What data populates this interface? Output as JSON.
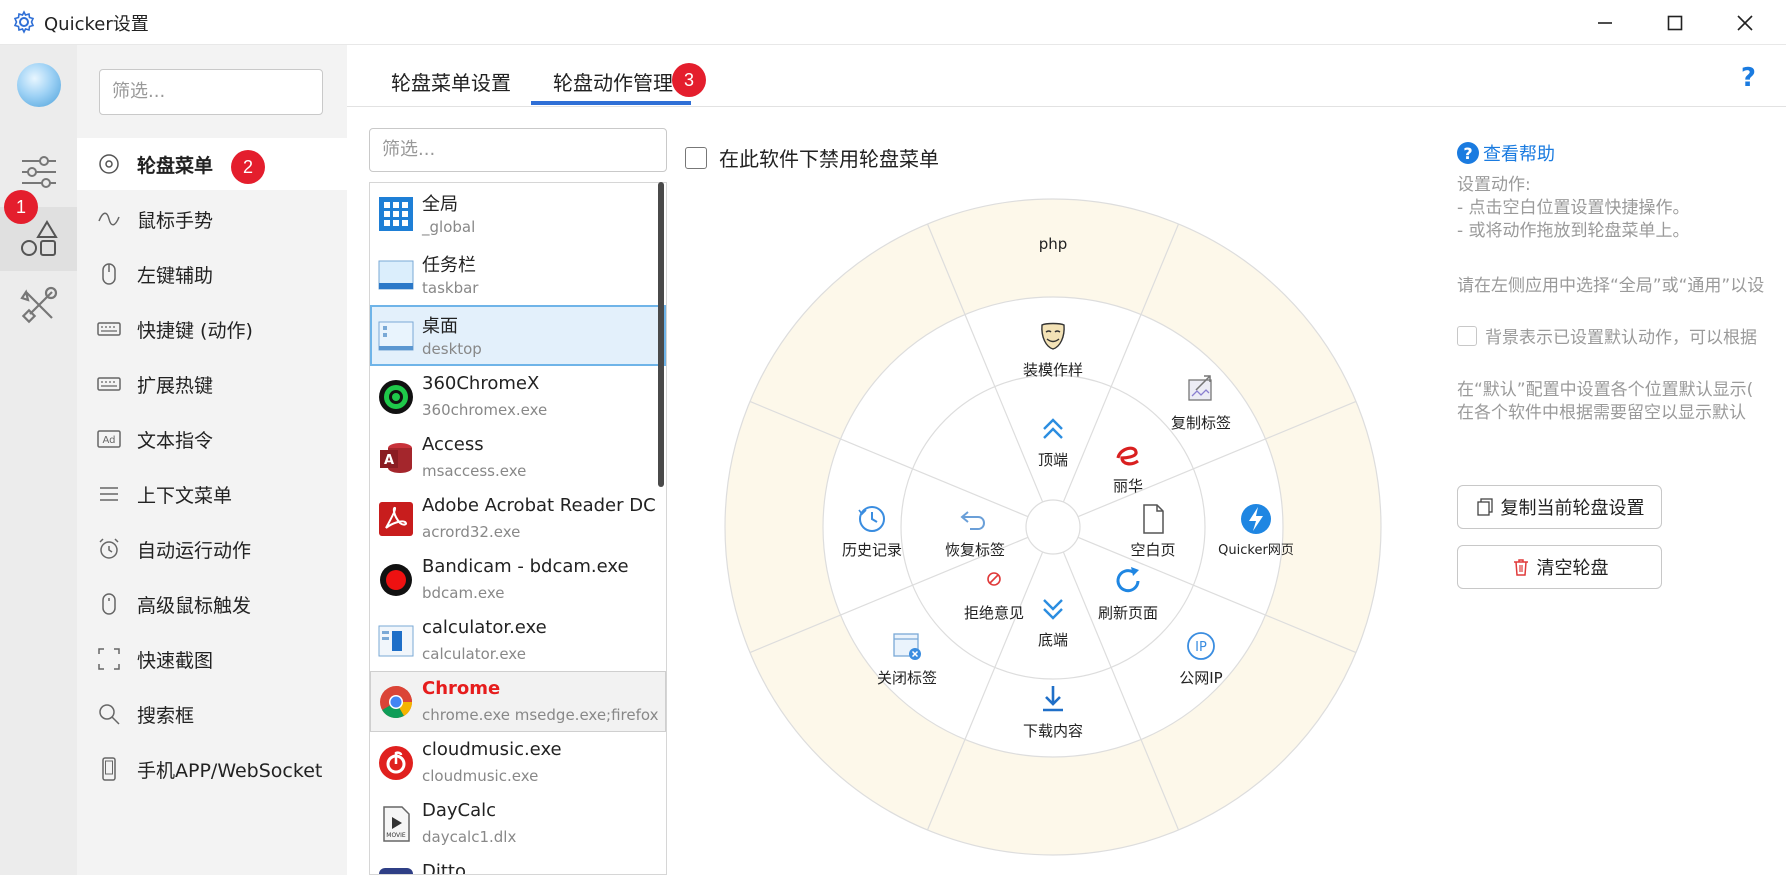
{
  "window": {
    "title": "Quicker设置",
    "controls": {
      "minimize": "minimize",
      "maximize": "maximize",
      "close": "close"
    }
  },
  "rail": {
    "items": [
      "avatar",
      "sliders-icon",
      "shapes-icon",
      "tools-icon"
    ],
    "badge": "1"
  },
  "sidebar": {
    "filter_placeholder": "筛选...",
    "items": [
      {
        "label": "轮盘菜单",
        "icon": "circle-dot-icon"
      },
      {
        "label": "鼠标手势",
        "icon": "wave-icon"
      },
      {
        "label": "左键辅助",
        "icon": "mouse-icon"
      },
      {
        "label": "快捷键 (动作)",
        "icon": "keyboard-icon"
      },
      {
        "label": "扩展热键",
        "icon": "keyboard-icon"
      },
      {
        "label": "文本指令",
        "icon": "ad-icon"
      },
      {
        "label": "上下文菜单",
        "icon": "menu-lines-icon"
      },
      {
        "label": "自动运行动作",
        "icon": "alarm-icon"
      },
      {
        "label": "高级鼠标触发",
        "icon": "mouse-icon"
      },
      {
        "label": "快速截图",
        "icon": "screenshot-icon"
      },
      {
        "label": "搜索框",
        "icon": "search-icon"
      },
      {
        "label": "手机APP/WebSocket",
        "icon": "phone-icon"
      }
    ],
    "badge": "2"
  },
  "tabs": {
    "items": [
      "轮盘菜单设置",
      "轮盘动作管理"
    ],
    "active": 1,
    "badge": "3",
    "help": "?"
  },
  "apps": {
    "filter_placeholder": "筛选...",
    "items": [
      {
        "name": "全局",
        "sub": "_global",
        "icon": "grid-icon"
      },
      {
        "name": "任务栏",
        "sub": "taskbar",
        "icon": "taskbar-icon"
      },
      {
        "name": "桌面",
        "sub": "desktop",
        "icon": "desktop-icon"
      },
      {
        "name": "360ChromeX",
        "sub": "360chromex.exe",
        "icon": "360chrome-icon"
      },
      {
        "name": "Access",
        "sub": "msaccess.exe",
        "icon": "access-icon"
      },
      {
        "name": "Adobe Acrobat Reader DC",
        "sub": "acrord32.exe",
        "icon": "acrobat-icon"
      },
      {
        "name": "Bandicam - bdcam.exe",
        "sub": "bdcam.exe",
        "icon": "bandicam-icon"
      },
      {
        "name": "calculator.exe",
        "sub": "calculator.exe",
        "icon": "calculator-icon"
      },
      {
        "name": "Chrome",
        "sub": "chrome.exe  msedge.exe;firefox",
        "icon": "chrome-icon"
      },
      {
        "name": "cloudmusic.exe",
        "sub": "cloudmusic.exe",
        "icon": "cloudmusic-icon"
      },
      {
        "name": "DayCalc",
        "sub": "daycalc1.dlx",
        "icon": "movie-icon"
      },
      {
        "name": "Ditto",
        "sub": "",
        "icon": "ditto-icon"
      }
    ]
  },
  "main": {
    "disable_label": "在此软件下禁用轮盘菜单"
  },
  "wheel": {
    "outer_top": "php",
    "actions": [
      {
        "label": "装模作样",
        "icon": "mask-icon"
      },
      {
        "label": "复制标签",
        "icon": "copy-tag-icon"
      },
      {
        "label": "顶端",
        "icon": "double-up-icon"
      },
      {
        "label": "丽华",
        "icon": "lihua-icon"
      },
      {
        "label": "历史记录",
        "icon": "history-icon"
      },
      {
        "label": "恢复标签",
        "icon": "undo-icon"
      },
      {
        "label": "空白页",
        "icon": "blank-page-icon"
      },
      {
        "label": "Quicker网页",
        "icon": "quicker-icon"
      },
      {
        "label": "拒绝意见",
        "icon": "forbidden-icon"
      },
      {
        "label": "刷新页面",
        "icon": "refresh-icon"
      },
      {
        "label": "底端",
        "icon": "double-down-icon"
      },
      {
        "label": "关闭标签",
        "icon": "close-tab-icon"
      },
      {
        "label": "公网IP",
        "icon": "ip-icon"
      },
      {
        "label": "下载内容",
        "icon": "download-icon"
      }
    ]
  },
  "info": {
    "help_link": "查看帮助",
    "lines": [
      "设置动作:",
      "- 点击空白位置设置快捷操作。",
      "- 或将动作拖放到轮盘菜单上。",
      "",
      "请在左侧应用中选择“全局”或“通用”以设",
      "",
      "背景表示已设置默认动作，可以根据",
      "",
      "在“默认”配置中设置各个位置默认显示(",
      "在各个软件中根据需要留空以显示默认"
    ],
    "copy_button": "复制当前轮盘设置",
    "clear_button": "清空轮盘"
  },
  "colors": {
    "accent": "#2f6fd6",
    "link": "#1a7be0",
    "badge": "#e41e2d",
    "wheel_fill": "#fdf8ea",
    "selection": "#e3f0fb"
  }
}
